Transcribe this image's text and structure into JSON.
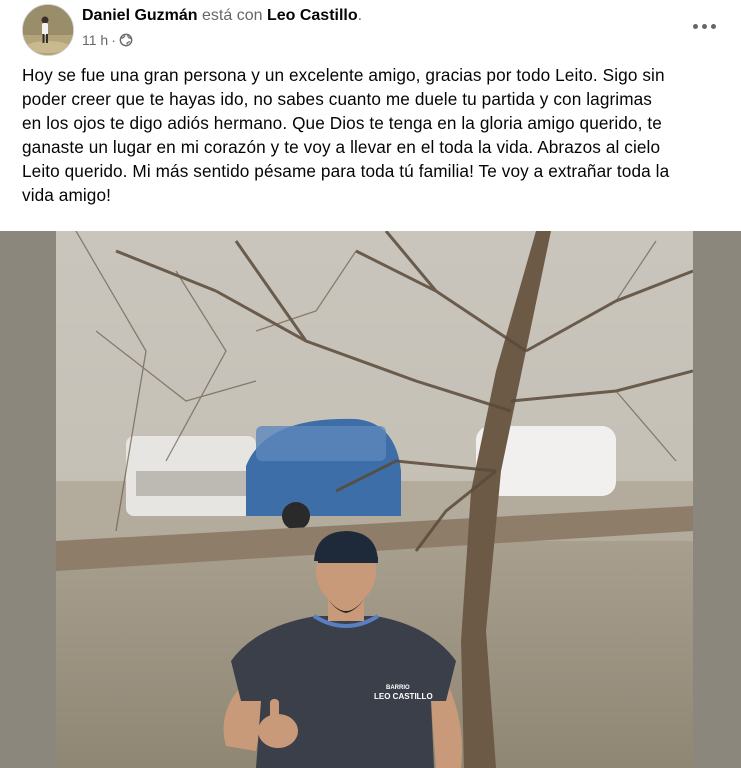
{
  "post": {
    "author": "Daniel Guzmán",
    "connector": " está con ",
    "tagged": "Leo Castillo",
    "suffix": ".",
    "time": "11 h",
    "separator": "·",
    "privacy_icon": "globe-icon",
    "more_icon": "more-options-icon",
    "message": "Hoy se fue una gran persona y un excelente amigo, gracias por todo Leito. Sigo sin\npoder creer que te hayas ido, no sabes cuanto me duele tu partida y con lagrimas\nen los ojos te digo adiós hermano. Que Dios te tenga en la gloria amigo querido, te\nganaste un lugar en mi corazón y te voy a llevar en el toda la vida. Abrazos al cielo\nLeito querido. Mi más sentido pésame para toda tú familia! Te voy a extrañar toda la\nvida amigo!",
    "photo": {
      "shirt_logo": "LEO CASTILLO",
      "shirt_logo_small": "BARRIO"
    }
  },
  "colors": {
    "text_primary": "#050505",
    "text_secondary": "#65676b",
    "photo_side_bars": "#8b877d"
  }
}
